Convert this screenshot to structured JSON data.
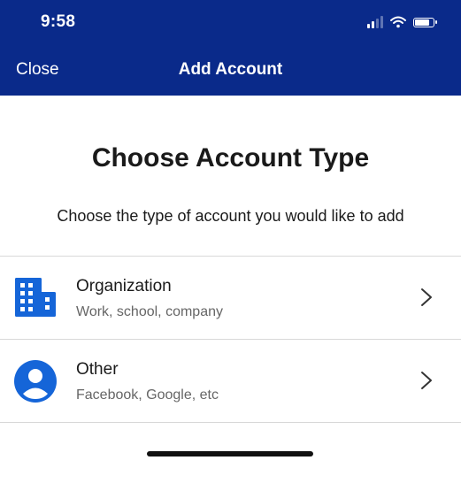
{
  "status_bar": {
    "time": "9:58",
    "signal_bars_active": 2,
    "battery_level": 0.8
  },
  "nav": {
    "close_label": "Close",
    "title": "Add Account"
  },
  "page": {
    "heading": "Choose Account Type",
    "subheading": "Choose the type of account you would like to add"
  },
  "options": [
    {
      "title": "Organization",
      "subtitle": "Work, school, company",
      "icon": "building-icon"
    },
    {
      "title": "Other",
      "subtitle": "Facebook, Google, etc",
      "icon": "person-icon"
    }
  ],
  "colors": {
    "header_bg": "#0a2a8a",
    "icon_blue": "#1565d8",
    "divider": "#d8d8d8"
  }
}
